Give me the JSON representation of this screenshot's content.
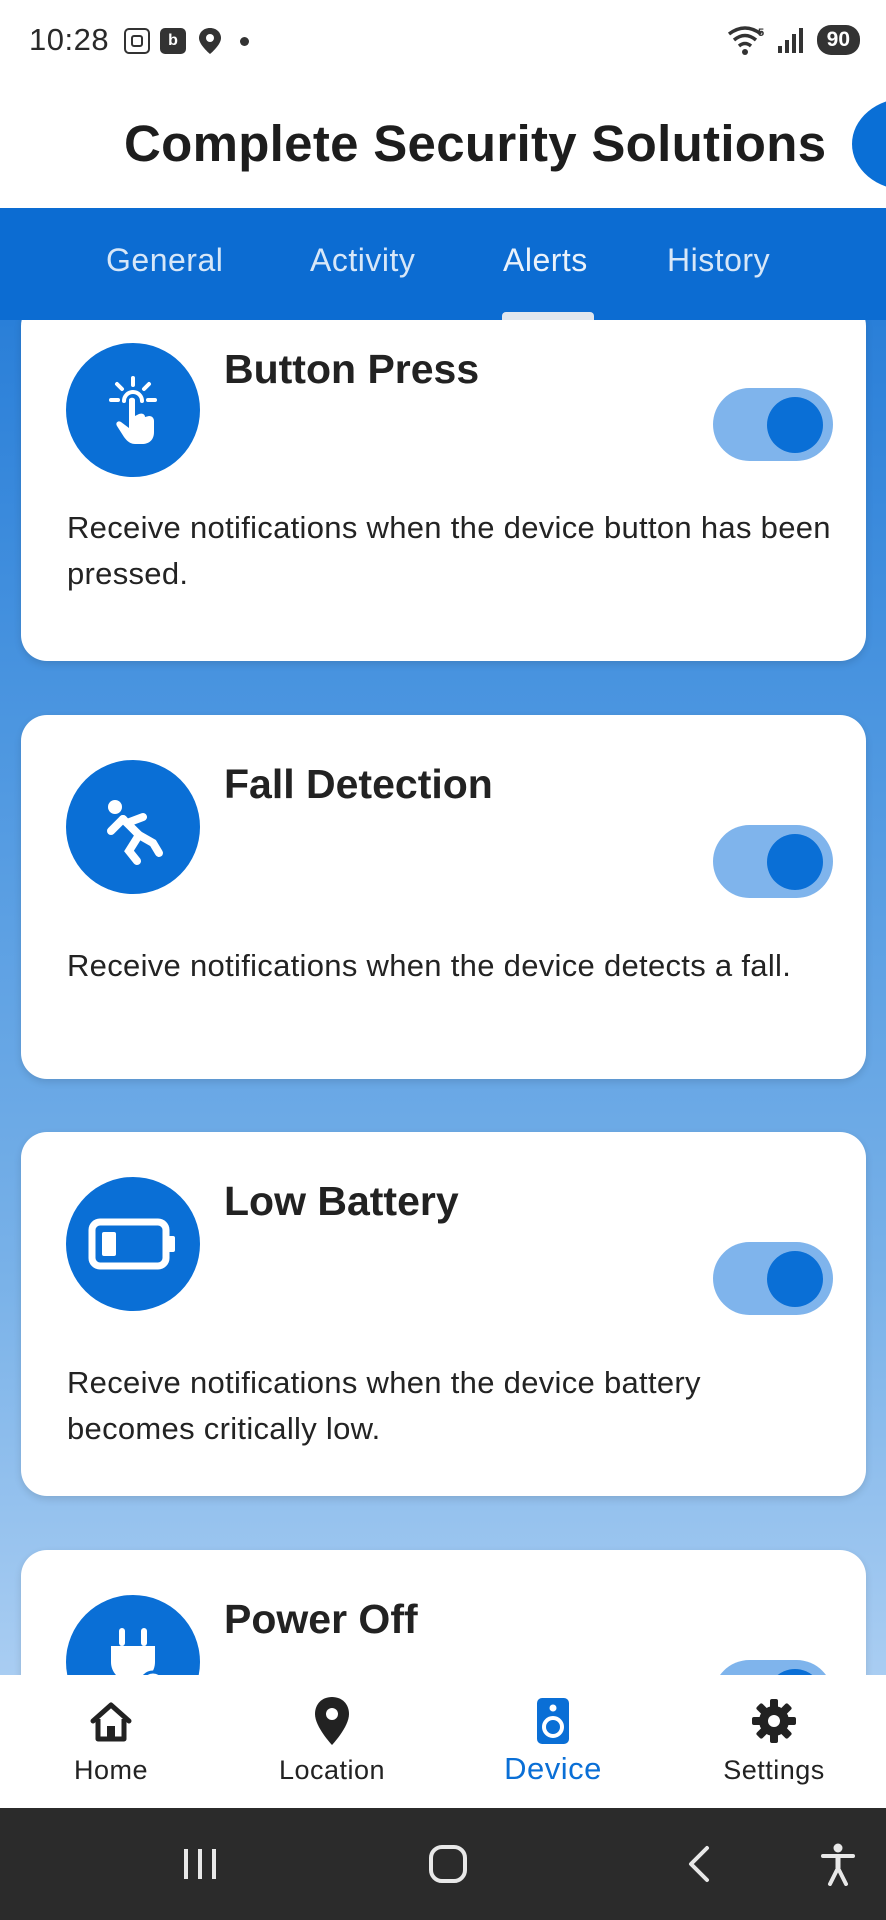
{
  "status_bar": {
    "time": "10:28",
    "left_icons": [
      "screenshot-icon",
      "b-app-icon",
      "location-shield-icon"
    ],
    "battery": "90",
    "right_icons": [
      "wifi-icon",
      "signal-icon"
    ]
  },
  "header": {
    "title": "Complete Security Solutions"
  },
  "tabs": [
    {
      "label": "General",
      "active": false
    },
    {
      "label": "Activity",
      "active": false
    },
    {
      "label": "Alerts",
      "active": true
    },
    {
      "label": "History",
      "active": false
    }
  ],
  "alerts": [
    {
      "title": "Button Press",
      "description": "Receive notifications when the device button has been pressed.",
      "icon": "button-press-icon",
      "enabled": true
    },
    {
      "title": "Fall Detection",
      "description": "Receive notifications when the device detects a fall.",
      "icon": "fall-detection-icon",
      "enabled": true
    },
    {
      "title": "Low Battery",
      "description": "Receive notifications when the device battery becomes critically low.",
      "icon": "low-battery-icon",
      "enabled": true
    },
    {
      "title": "Power Off",
      "description": "",
      "icon": "power-off-icon",
      "enabled": true
    }
  ],
  "bottom_nav": [
    {
      "label": "Home",
      "icon": "home-icon",
      "active": false
    },
    {
      "label": "Location",
      "icon": "location-pin-icon",
      "active": false
    },
    {
      "label": "Device",
      "icon": "device-icon",
      "active": true
    },
    {
      "label": "Settings",
      "icon": "gear-icon",
      "active": false
    }
  ],
  "colors": {
    "primary": "#0a6fd6",
    "toggle_track": "#7fb4ec",
    "gradient_top": "#2a7fd8",
    "gradient_bottom": "#a9cdf2"
  }
}
